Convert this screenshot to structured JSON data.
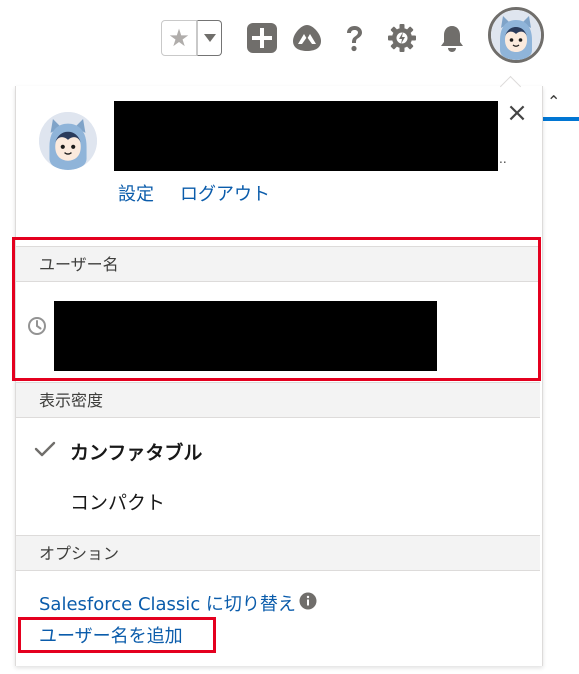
{
  "header": {
    "icons": [
      "star-icon",
      "chevron-down-icon",
      "plus-icon",
      "trailhead-icon",
      "help-icon",
      "setup-gear-icon",
      "bell-icon",
      "avatar"
    ]
  },
  "profile": {
    "links": {
      "settings": "設定",
      "logout": "ログアウト"
    },
    "ellipsis": ".."
  },
  "sections": {
    "username_header": "ユーザー名",
    "density_header": "表示密度",
    "options_header": "オプション"
  },
  "density": {
    "comfortable": "カンファタブル",
    "compact": "コンパクト",
    "selected": "comfortable"
  },
  "options": {
    "switch_classic": "Salesforce Classic に切り替え",
    "add_username": "ユーザー名を追加"
  },
  "colors": {
    "link": "#0b5cab",
    "highlight": "#e4001f",
    "header_icons": "#706e6b",
    "brand_blue": "#0176d3"
  }
}
